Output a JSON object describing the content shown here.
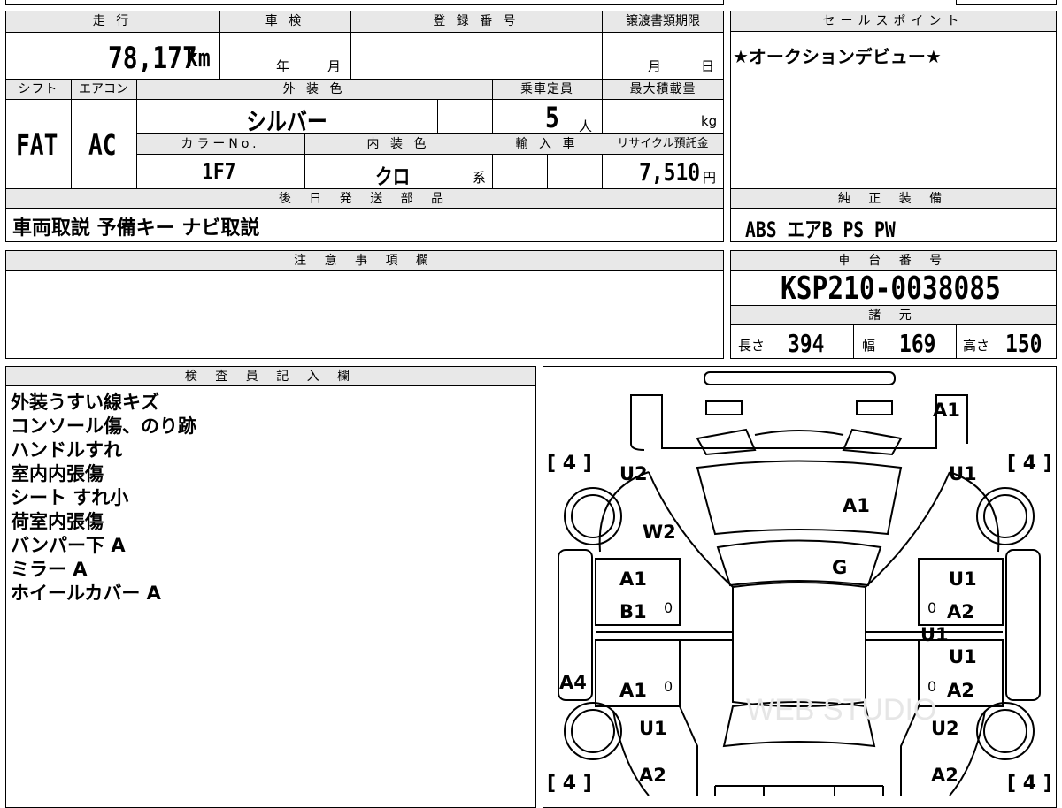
{
  "headers": {
    "mileage": "走 行",
    "inspection": "車 検",
    "registration": "登 録 番 号",
    "transfer_deadline": "譲渡書類期限",
    "sales_point": "セールスポイント",
    "shift": "シフト",
    "aircon": "エアコン",
    "exterior_color": "外 装 色",
    "capacity": "乗車定員",
    "max_load": "最大積載量",
    "color_no": "カラーNo.",
    "interior_color": "内 装 色",
    "import": "輸 入 車",
    "recycle_fee": "リサイクル預託金",
    "later_parts": "後 日 発 送 部 品",
    "genuine_equipment": "純 正 装 備",
    "caution": "注 意 事 項 欄",
    "chassis_no": "車 台 番 号",
    "specs": "諸 元",
    "inspector": "検 査 員 記 入 欄"
  },
  "values": {
    "mileage": "78,177",
    "mileage_unit": "km",
    "inspection_year_unit": "年",
    "inspection_month_unit": "月",
    "transfer_month_unit": "月",
    "transfer_day_unit": "日",
    "sales_point_text": "★オークションデビュー★",
    "shift": "FAT",
    "aircon": "AC",
    "exterior_color": "シルバー",
    "capacity": "5",
    "capacity_unit": "人",
    "max_load_unit": "kg",
    "color_no": "1F7",
    "interior_color": "クロ",
    "interior_suffix": "系",
    "recycle_fee": "7,510",
    "recycle_unit": "円",
    "later_parts": "車両取説 予備キー ナビ取説",
    "genuine_equipment": "ABS エアB PS PW",
    "chassis_no": "KSP210-0038085",
    "length_label": "長さ",
    "length": "394",
    "width_label": "幅",
    "width": "169",
    "height_label": "高さ",
    "height": "150"
  },
  "inspector_notes": [
    "外装うすい線キズ",
    "コンソール傷、のり跡",
    "ハンドルすれ",
    "室内内張傷",
    "シート すれ小",
    "荷室内張傷",
    "バンパー下 A",
    "ミラー A",
    "ホイールカバー A"
  ],
  "diagram": {
    "tire_depth": "4",
    "codes": [
      "A1",
      "U2",
      "U1",
      "A1",
      "W2",
      "G",
      "A1",
      "U1",
      "B1",
      "A2",
      "U1",
      "U1",
      "A4",
      "A1",
      "A2",
      "U1",
      "U2",
      "A2",
      "A2"
    ],
    "zeros": "0",
    "watermark": "WEB STUDIO"
  },
  "colors": {
    "header_bg": "#e8e8e8",
    "border": "#000000"
  }
}
